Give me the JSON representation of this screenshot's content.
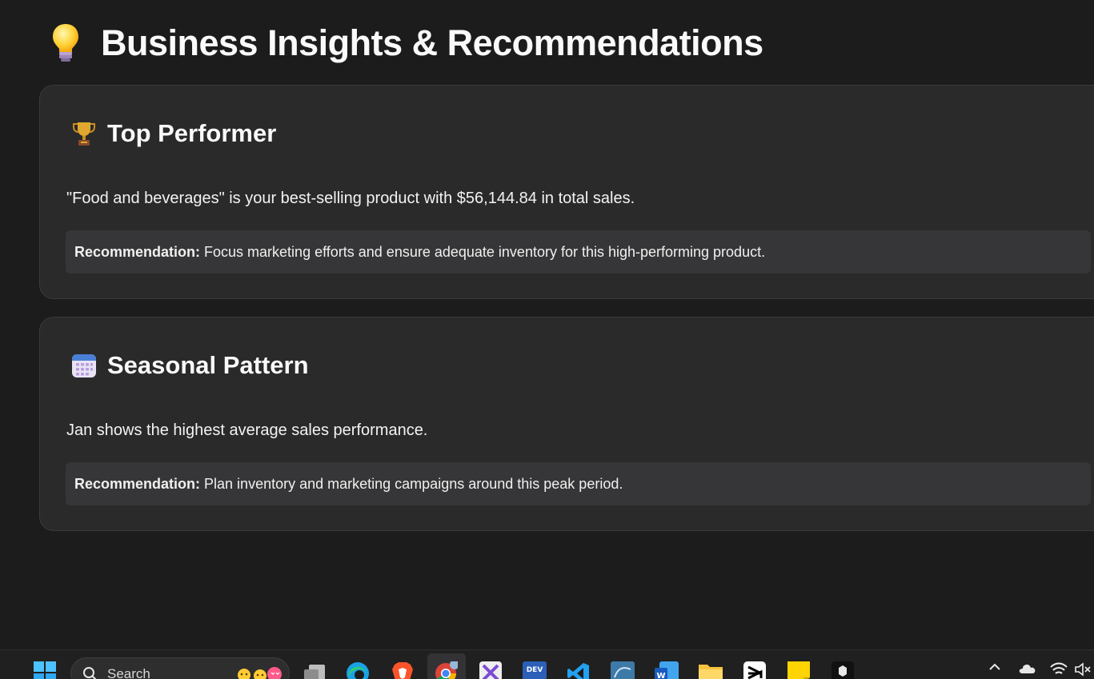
{
  "header": {
    "title": "Business Insights & Recommendations",
    "icon": "lightbulb-icon"
  },
  "insights": [
    {
      "icon": "trophy-icon",
      "title": "Top Performer",
      "text": "\"Food and beverages\" is your best-selling product with $56,144.84 in total sales.",
      "recommendation_label": "Recommendation:",
      "recommendation": "Focus marketing efforts and ensure adequate inventory for this high-performing product."
    },
    {
      "icon": "calendar-icon",
      "title": "Seasonal Pattern",
      "text": "Jan shows the highest average sales performance.",
      "recommendation_label": "Recommendation:",
      "recommendation": "Plan inventory and marketing campaigns around this peak period."
    }
  ],
  "taskbar": {
    "search_placeholder": "Search",
    "apps": [
      "windows-start-icon",
      "task-view-icon",
      "edge-icon",
      "brave-icon",
      "chrome-icon",
      "app-icon",
      "dev-icon",
      "vscode-icon",
      "mysql-workbench-icon",
      "word-icon",
      "file-explorer-icon",
      "capcut-icon",
      "sticky-notes-icon",
      "app-icon"
    ],
    "tray": [
      "chevron-up-icon",
      "cloud-icon",
      "wifi-icon",
      "speaker-muted-icon"
    ]
  },
  "colors": {
    "background": "#1c1c1d",
    "card": "#2a2a2b",
    "recommendation_box": "#363638"
  }
}
